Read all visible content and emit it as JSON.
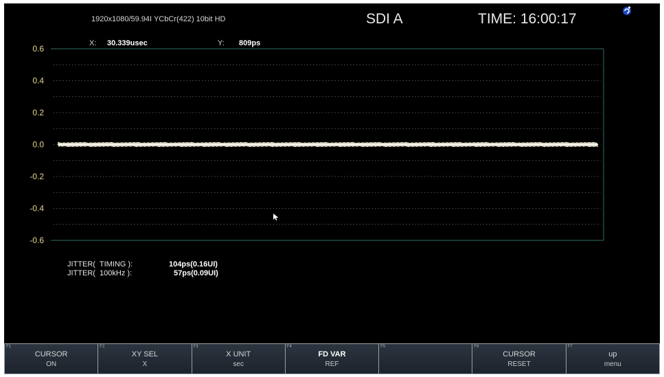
{
  "header": {
    "format": "1920x1080/59.94I YCbCr(422) 10bit HD",
    "input": "SDI A",
    "time": "TIME: 16:00:17",
    "logo_icon": "swirl-logo-icon"
  },
  "cursor": {
    "x_label": "X:",
    "x_value": "30.339usec",
    "y_label": "Y:",
    "y_value": "809ps"
  },
  "chart_data": {
    "type": "line",
    "title": "",
    "xlabel": "",
    "ylabel": "",
    "ylim": [
      -0.6,
      0.6
    ],
    "y_ticks": [
      "0.6",
      "0.4",
      "0.2",
      "0.0",
      "-0.2",
      "-0.4",
      "-0.6"
    ],
    "grid": true,
    "series": [
      {
        "values": [
          0.0,
          0.0,
          0.0,
          0.0,
          0.0,
          0.0,
          0.0,
          0.0,
          0.0,
          0.0,
          0.0
        ]
      }
    ],
    "colors": {
      "trace": "#f2efd8",
      "axis": "#2f6b66",
      "tick": "#e0d88c"
    }
  },
  "jitter": {
    "timing_label": "JITTER(  TIMING ):",
    "timing_value": "104ps(0.16UI)",
    "khz_label": "JITTER(  100kHz ):",
    "khz_value": "57ps(0.09UI)"
  },
  "softkeys": [
    {
      "fn": "F1",
      "label": "CURSOR",
      "value": "ON"
    },
    {
      "fn": "F2",
      "label": "XY SEL",
      "value": "X"
    },
    {
      "fn": "F3",
      "label": "X UNIT",
      "value": "sec"
    },
    {
      "fn": "F4",
      "label": "FD VAR",
      "value": "REF"
    },
    {
      "fn": "F5",
      "label": "",
      "value": ""
    },
    {
      "fn": "F6",
      "label": "CURSOR",
      "value": "RESET"
    },
    {
      "fn": "F7",
      "label": "up",
      "value": "menu"
    }
  ]
}
